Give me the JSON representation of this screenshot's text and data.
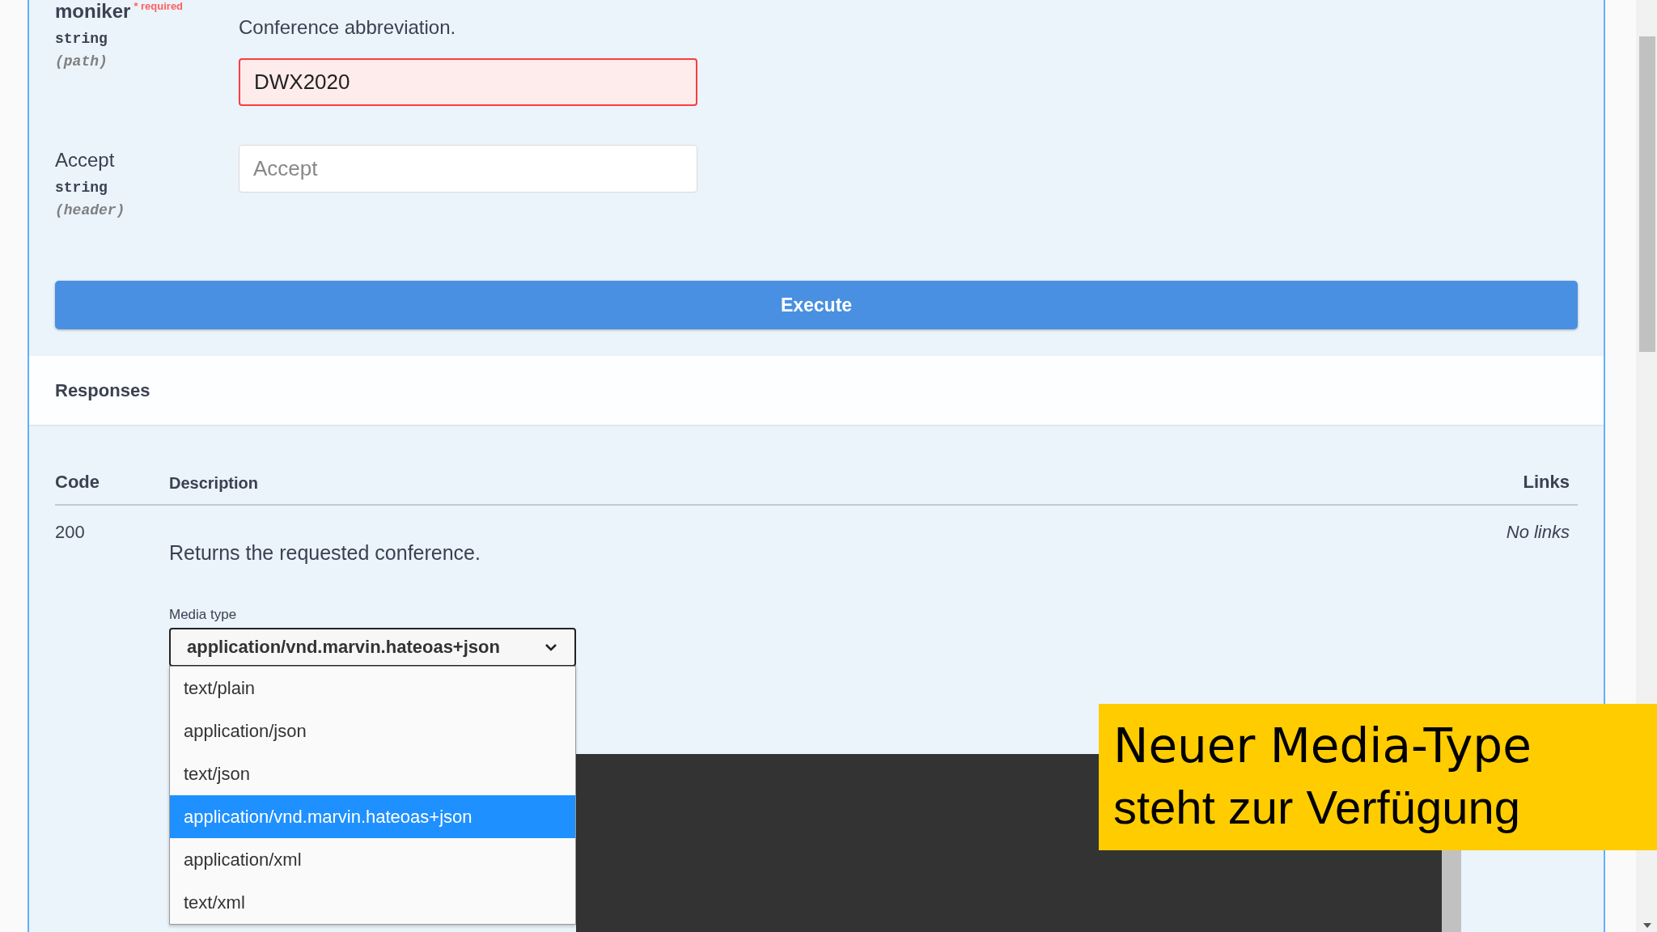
{
  "parameters": [
    {
      "name": "moniker",
      "required_mark": "* required",
      "type": "string",
      "location": "(path)",
      "description": "Conference abbreviation.",
      "value": "DWX2020",
      "invalid": true
    },
    {
      "name": "Accept",
      "type": "string",
      "location": "(header)",
      "placeholder": "Accept",
      "invalid": false
    }
  ],
  "execute_button": "Execute",
  "responses": {
    "title": "Responses",
    "columns": [
      "Code",
      "Description",
      "Links"
    ],
    "rows": [
      {
        "code": "200",
        "description": "Returns the requested conference.",
        "links": "No links",
        "media_type": {
          "label": "Media type",
          "value": "application/vnd.marvin.hateoas+json",
          "expanded": true,
          "options": [
            {
              "label": "text/plain",
              "selected": false
            },
            {
              "label": "application/json",
              "selected": false
            },
            {
              "label": "text/json",
              "selected": false
            },
            {
              "label": "application/vnd.marvin.hateoas+json",
              "selected": true
            },
            {
              "label": "application/xml",
              "selected": false
            },
            {
              "label": "text/xml",
              "selected": false
            }
          ]
        }
      }
    ]
  },
  "caption": {
    "title": "Neuer Media-Type",
    "subtitle": "steht zur Verfügung"
  }
}
